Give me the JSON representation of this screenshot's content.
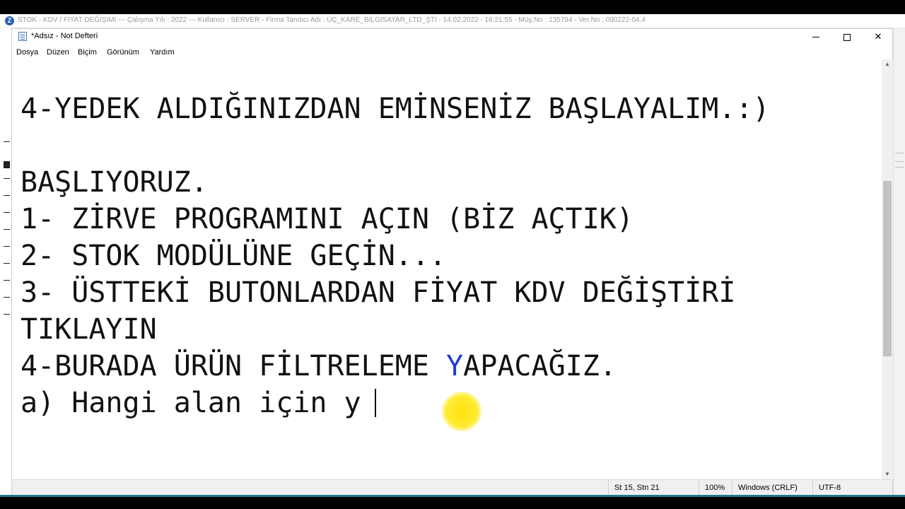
{
  "background_app": {
    "title": "STOK - KDV / FİYAT DEĞİŞİMİ  ---  Çalışma Yılı : 2022  ---  Kullanıcı : SERVER - Firma Tanıtıcı Adı : ÜÇ_KARE_BILGISAYAR_LTD_ŞTİ - 14.02.2022 - 16:21:55 - Müş.No : 135794 - Ver.No : 090222-04.4",
    "icon_letter": "Z"
  },
  "window": {
    "title": "*Adsız - Not Defteri",
    "minimize_glyph": "",
    "close_glyph": "✕"
  },
  "menu": {
    "items": [
      "Dosya",
      "Düzen",
      "Biçim",
      "Görünüm",
      "Yardım"
    ]
  },
  "editor": {
    "lines": [
      "4-YEDEK ALDIĞINIZDAN EMİNSENİZ BAŞLAYALIM.:)",
      "",
      "BAŞLIYORUZ.",
      "1- ZİRVE PROGRAMINI AÇIN (BİZ AÇTIK)",
      "2- STOK MODÜLÜNE GEÇİN...",
      "3- ÜSTTEKİ BUTONLARDAN FİYAT KDV DEĞİŞTİRİ",
      "TIKLAYIN",
      "4-BURADA ÜRÜN FİLTRELEME YAPACAĞIZ.",
      "a) Hangi alan için y"
    ],
    "line8_before": "4-BURADA ÜRÜN FİLTRELEME ",
    "line8_highlight": "Y",
    "line8_after": "APACAĞIZ."
  },
  "scrollbar": {
    "up_glyph": "▲",
    "down_glyph": "▼"
  },
  "status": {
    "position": "St 15, Stn 21",
    "zoom": "100%",
    "line_endings": "Windows (CRLF)",
    "encoding": "UTF-8"
  },
  "colors": {
    "highlight_text": "#1d3bd6",
    "pointer": "#ffe000"
  }
}
